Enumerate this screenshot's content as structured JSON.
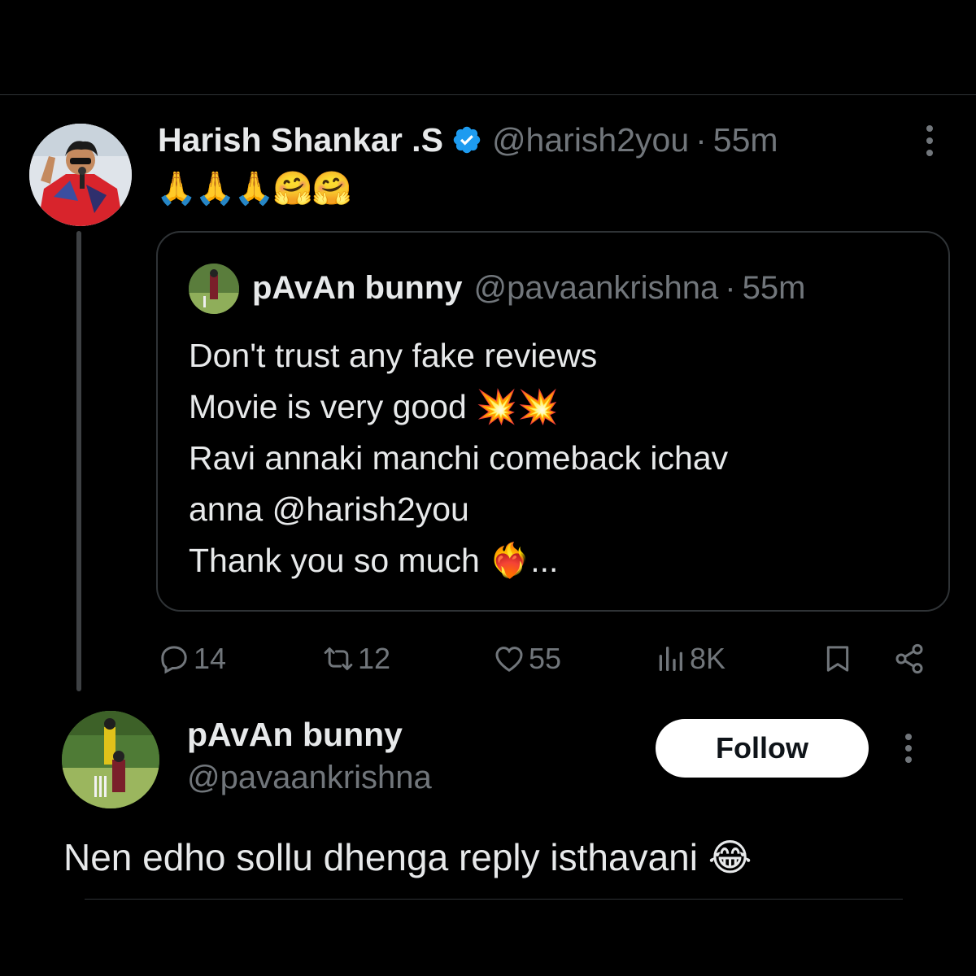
{
  "main_tweet": {
    "display_name": "Harish Shankar .S",
    "handle": "@harish2you",
    "separator": "·",
    "time": "55m",
    "text": "🙏🙏🙏🤗🤗",
    "verified": true,
    "accent_color": "#1d9bf0"
  },
  "quoted_tweet": {
    "display_name": "pAvAn bunny",
    "handle": "@pavaankrishna",
    "separator": "·",
    "time": "55m",
    "lines": [
      "Don't trust any fake reviews",
      "Movie is very good 💥💥",
      "Ravi annaki manchi comeback ichav",
      "anna @harish2you",
      "Thank you so much ❤️‍🔥..."
    ]
  },
  "actions": {
    "replies": "14",
    "retweets": "12",
    "likes": "55",
    "views": "8K",
    "icons": [
      "reply-icon",
      "retweet-icon",
      "like-icon",
      "views-icon",
      "bookmark-icon",
      "share-icon"
    ]
  },
  "reply": {
    "display_name": "pAvAn bunny",
    "handle": "@pavaankrishna",
    "follow_label": "Follow",
    "text": "Nen edho sollu dhenga reply isthavani 😂"
  },
  "colors": {
    "background": "#000000",
    "text": "#e7e9ea",
    "secondary_text": "#71767b",
    "border": "#2f3336"
  }
}
